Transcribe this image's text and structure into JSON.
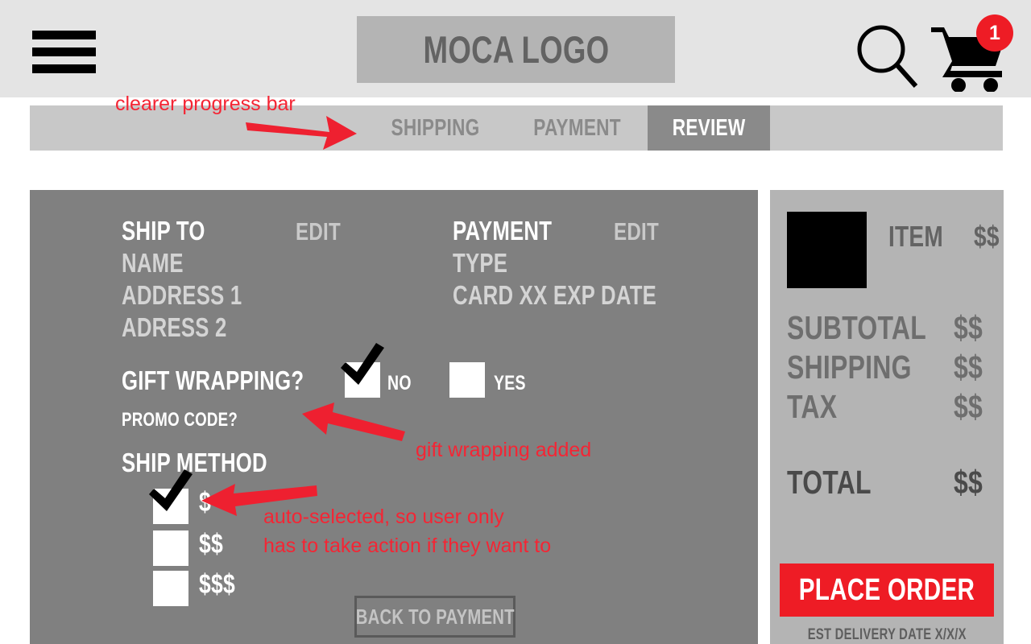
{
  "header": {
    "menu_icon": "hamburger-menu-icon",
    "logo_text": "MOCA LOGO",
    "search_icon": "search-icon",
    "cart_icon": "shopping-cart-icon",
    "cart_count": "1"
  },
  "progress": {
    "tabs": [
      {
        "label": "SHIPPING",
        "active": false
      },
      {
        "label": "PAYMENT",
        "active": false
      },
      {
        "label": "REVIEW",
        "active": true
      }
    ]
  },
  "main": {
    "ship_to": {
      "heading": "SHIP TO",
      "edit_label": "EDIT",
      "lines": [
        "NAME",
        "ADDRESS 1",
        "ADRESS 2"
      ]
    },
    "payment": {
      "heading": "PAYMENT",
      "edit_label": "EDIT",
      "lines": [
        "TYPE",
        "CARD XX  EXP DATE"
      ]
    },
    "gift_wrapping": {
      "label": "GIFT WRAPPING?",
      "options": [
        {
          "label": "NO",
          "checked": true
        },
        {
          "label": "YES",
          "checked": false
        }
      ]
    },
    "promo_code_label": "PROMO CODE?",
    "ship_method": {
      "label": "SHIP METHOD",
      "options": [
        {
          "price": "$",
          "checked": true
        },
        {
          "price": "$$",
          "checked": false
        },
        {
          "price": "$$$",
          "checked": false
        }
      ]
    },
    "back_button_label": "BACK TO PAYMENT"
  },
  "summary": {
    "item": {
      "name": "ITEM",
      "price": "$$",
      "thumbnail": "product-thumbnail"
    },
    "totals": [
      {
        "label": "SUBTOTAL",
        "value": "$$"
      },
      {
        "label": "SHIPPING",
        "value": "$$"
      },
      {
        "label": "TAX",
        "value": "$$"
      }
    ],
    "grand_total": {
      "label": "TOTAL",
      "value": "$$"
    },
    "place_order_label": "PLACE ORDER",
    "est_delivery": "EST DELIVERY DATE X/X/X"
  },
  "annotations": [
    {
      "text": "clearer progress bar"
    },
    {
      "text": "gift wrapping added"
    },
    {
      "text": "auto-selected, so user only\nhas to take action if they want to"
    }
  ],
  "colors": {
    "accent_red": "#ee1c25",
    "annotation_red": "#f42534",
    "panel_gray": "#808080",
    "sidebar_gray": "#b4b4b4",
    "header_gray": "#e4e4e4",
    "progress_gray": "#c8c8c8",
    "active_tab_gray": "#8a8a8a"
  }
}
